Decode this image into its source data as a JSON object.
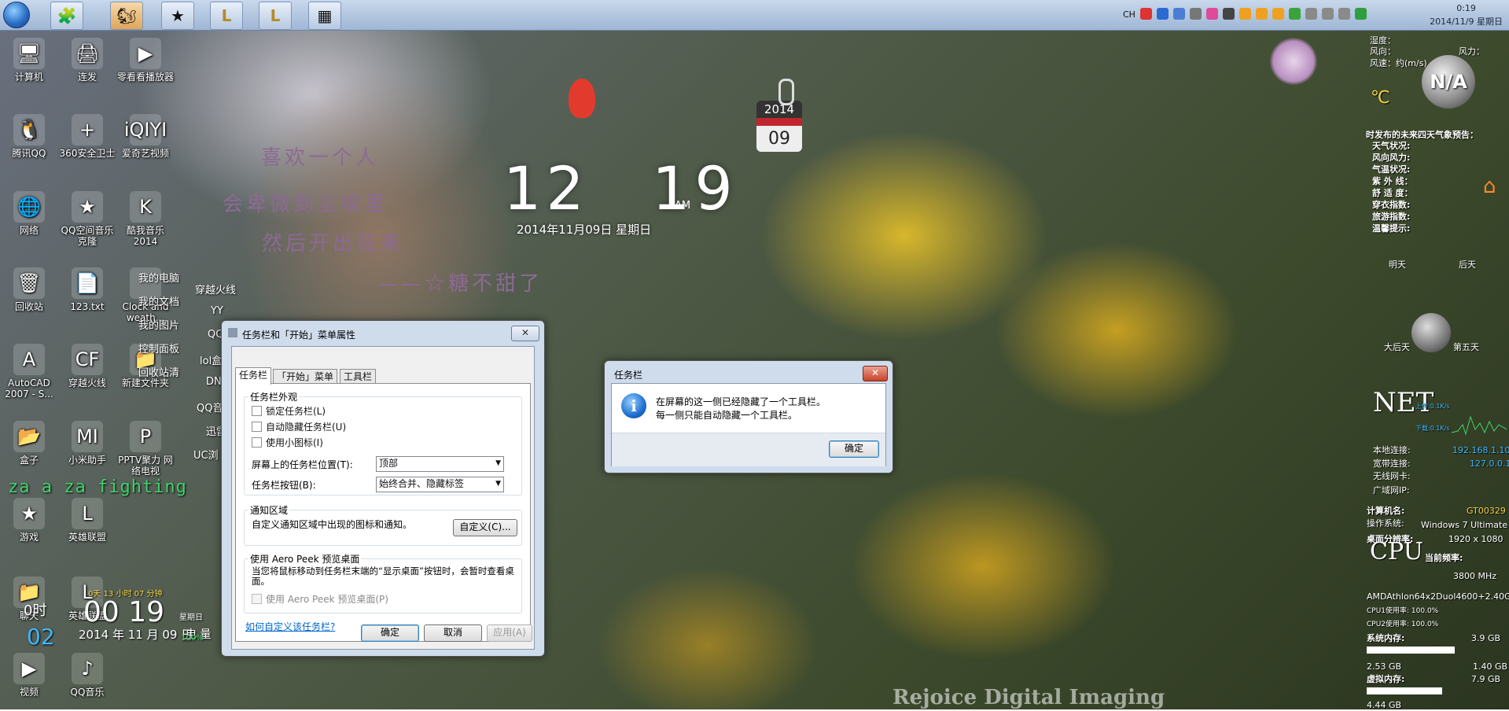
{
  "taskbar": {
    "clock_time": "0:19",
    "clock_date": "2014/11/9 星期日",
    "lang": "CH"
  },
  "desktop_icons": [
    {
      "label": "计算机",
      "glyph": "🖥"
    },
    {
      "label": "连发",
      "glyph": "🖨"
    },
    {
      "label": "零看看播放器",
      "glyph": "▶"
    },
    {
      "label": "腾讯QQ",
      "glyph": "🐧"
    },
    {
      "label": "360安全卫士",
      "glyph": "+"
    },
    {
      "label": "爱奇艺视频",
      "glyph": "iQIYI"
    },
    {
      "label": "网络",
      "glyph": "🌐"
    },
    {
      "label": "QQ空间音乐克隆",
      "glyph": "★"
    },
    {
      "label": "酷我音乐2014",
      "glyph": "K"
    },
    {
      "label": "回收站",
      "glyph": "🗑"
    },
    {
      "label": "123.txt",
      "glyph": "📄"
    },
    {
      "label": "Clock and weath...",
      "glyph": ""
    },
    {
      "label": "AutoCAD 2007 - S...",
      "glyph": "A"
    },
    {
      "label": "穿越火线",
      "glyph": "CF"
    },
    {
      "label": "新建文件夹",
      "glyph": "📁"
    },
    {
      "label": "盒子",
      "glyph": "📂"
    },
    {
      "label": "小米助手",
      "glyph": "MI"
    },
    {
      "label": "PPTV聚力 网络电视",
      "glyph": "P"
    },
    {
      "label": "游戏",
      "glyph": "★"
    },
    {
      "label": "英雄联盟",
      "glyph": "L"
    },
    {
      "label": "聊天",
      "glyph": "📁"
    },
    {
      "label": "英雄联盟",
      "glyph": "L"
    },
    {
      "label": "视频",
      "glyph": "▶"
    },
    {
      "label": "QQ音乐",
      "glyph": "♪"
    }
  ],
  "launcher_menu": [
    "穿越火线",
    "YY",
    "QQ",
    "lol盒",
    "DN",
    "QQ音",
    "迅雷",
    "UC浏"
  ],
  "folder_list": [
    "我的电脑",
    "我的文档",
    "我的图片",
    "控制面板",
    "回收站清"
  ],
  "overlay_text": "za a za fighting",
  "poem": {
    "line1": "喜欢一个人",
    "line2": "会卑微到尘埃里",
    "line3": "然后开出花来",
    "line4": "——☆糖不甜了"
  },
  "big_clock": {
    "hours": "12",
    "minutes": "19",
    "ampm": "AM",
    "date": "2014年11月09日 星期日"
  },
  "calendar_widget": {
    "year": "2014",
    "day": "09"
  },
  "small_clock": {
    "countdown": "0天 13 小时 07 分钟",
    "hour_label": "0时",
    "time": "00 19",
    "weekday": "星期日",
    "seconds": "02",
    "date": "2014 年 11 月 09 日",
    "battery_label": "电 量",
    "battery": "100%"
  },
  "weather": {
    "humidity": "湿度：",
    "wind_dir": "风向：",
    "wind_force": "风力：",
    "wind_speed": "风速：约(m/s)",
    "badge": "N/A",
    "temp": "℃",
    "forecast_title": "时发布的未来四天气象预告：",
    "rows": [
      "天气状况:",
      "风向风力:",
      "气温状况:",
      "紫 外 线：",
      "舒 适 度：",
      "穿衣指数:",
      "旅游指数:",
      "温馨提示:"
    ],
    "day2": "明天",
    "day3": "后天",
    "day4": "大后天",
    "day5": "第五天"
  },
  "net": {
    "title": "NET",
    "up": "上传:0.1K/s",
    "down": "下载:0.1K/s",
    "local_label": "本地连接:",
    "local_value": "192.168.1.101",
    "broadband_label": "宽带连接:",
    "broadband_value": "127.0.0.1",
    "wifi_label": "无线网卡:",
    "wan_label": "广域网IP:"
  },
  "sysinfo": {
    "pcname_label": "计算机名:",
    "pcname_value": "GT00329",
    "os_label": "操作系统:",
    "os_value": "Windows 7 Ultimate",
    "res_label": "桌面分辨率:",
    "res_value": "1920 x 1080",
    "cpu_title": "CPU",
    "freq_label": "当前频率:",
    "freq_value": "3800 MHz",
    "cpu_model": "AMDAthlon64x2Duol4600+2.40GHz",
    "cpu1": "CPU1使用率: 100.0%",
    "cpu2": "CPU2使用率: 100.0%",
    "mem_label": "系统内存:",
    "mem_total": "3.9 GB",
    "mem_used": "2.53 GB",
    "mem_free": "1.40 GB",
    "vmem_label": "虚拟内存:",
    "vmem_total": "7.9 GB",
    "vmem_used": "4.44 GB",
    "mem_fraction": 0.65,
    "vmem_fraction": 0.56
  },
  "taskbar_dialog": {
    "title": "任务栏和「开始」菜单属性",
    "tabs": [
      "任务栏",
      "「开始」菜单",
      "工具栏"
    ],
    "appearance_group": "任务栏外观",
    "lock": "锁定任务栏(L)",
    "autohide": "自动隐藏任务栏(U)",
    "small_icons": "使用小图标(I)",
    "position_label": "屏幕上的任务栏位置(T):",
    "position_value": "顶部",
    "buttons_label": "任务栏按钮(B):",
    "buttons_value": "始终合并、隐藏标签",
    "notify_group": "通知区域",
    "notify_text": "自定义通知区域中出现的图标和通知。",
    "customize": "自定义(C)...",
    "peek_group": "使用 Aero Peek 预览桌面",
    "peek_text": "当您将鼠标移动到任务栏末端的“显示桌面”按钮时，会暂时查看桌面。",
    "peek_check": "使用 Aero Peek 预览桌面(P)",
    "help_link": "如何自定义该任务栏?",
    "ok": "确定",
    "cancel": "取消",
    "apply": "应用(A)"
  },
  "msg_dialog": {
    "title": "任务栏",
    "line1": "在屏幕的这一侧已经隐藏了一个工具栏。",
    "line2": "每一侧只能自动隐藏一个工具栏。",
    "ok": "确定"
  },
  "watermark": "Rejoice Digital Imaging",
  "colors": {
    "poem": "#8c6a94",
    "overlay_green": "#3fd46a",
    "net_blue": "#3fb7ff",
    "info_green": "#7cff7c"
  }
}
